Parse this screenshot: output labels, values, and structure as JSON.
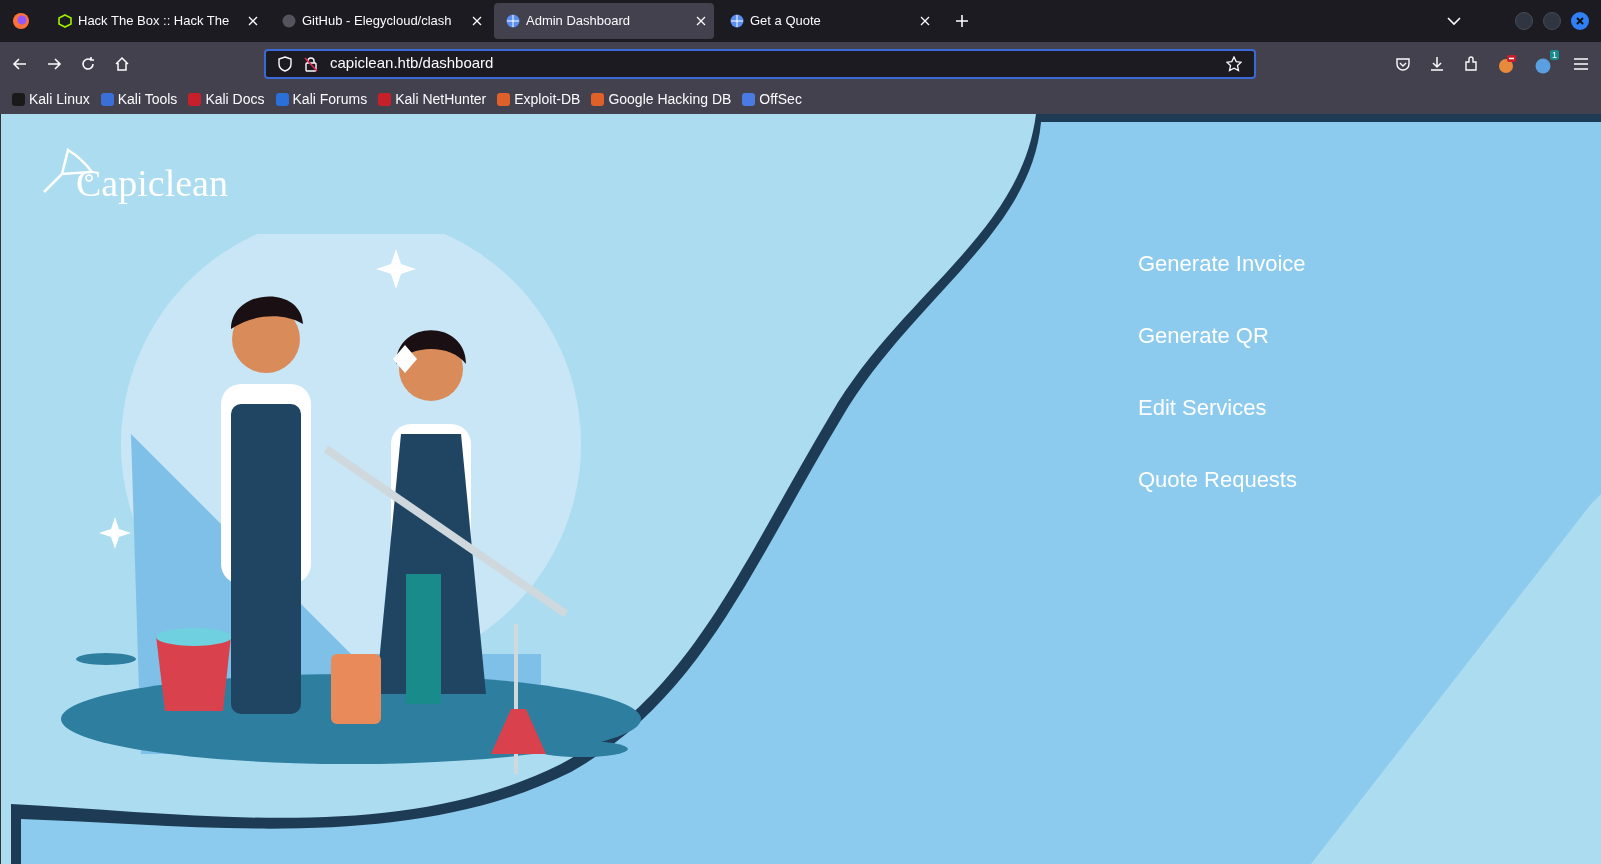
{
  "tabs": [
    {
      "title": "Hack The Box :: Hack The",
      "kind": "htb",
      "selected": false
    },
    {
      "title": "GitHub - Elegycloud/clash",
      "kind": "github",
      "selected": false
    },
    {
      "title": "Admin Dashboard",
      "kind": "globe",
      "selected": true
    },
    {
      "title": "Get a Quote",
      "kind": "globe",
      "selected": false
    }
  ],
  "address_bar": {
    "value": "capiclean.htb/dashboard"
  },
  "toolbar": {
    "extension_badge": "1"
  },
  "bookmarks": [
    {
      "label": "Kali Linux",
      "color": "#1a1a1a"
    },
    {
      "label": "Kali Tools",
      "color": "#3b6fd8"
    },
    {
      "label": "Kali Docs",
      "color": "#c8202a"
    },
    {
      "label": "Kali Forums",
      "color": "#2b6fd8"
    },
    {
      "label": "Kali NetHunter",
      "color": "#c8202a"
    },
    {
      "label": "Exploit-DB",
      "color": "#e0602a"
    },
    {
      "label": "Google Hacking DB",
      "color": "#e0602a"
    },
    {
      "label": "OffSec",
      "color": "#4a7be0"
    }
  ],
  "page": {
    "logo": "Capiclean",
    "menu": [
      "Generate Invoice",
      "Generate QR",
      "Edit Services",
      "Quote Requests"
    ]
  }
}
